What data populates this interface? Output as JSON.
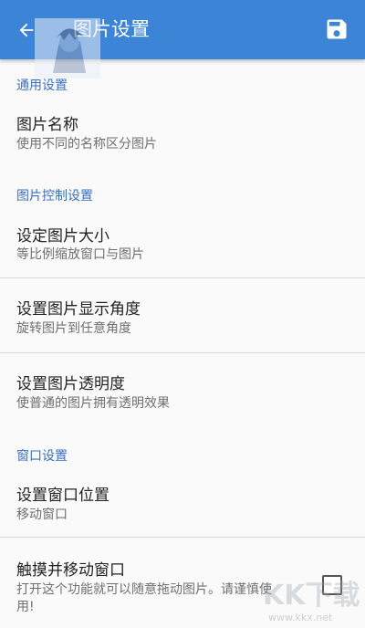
{
  "header": {
    "title": "图片设置",
    "back_icon": "arrow-left-icon",
    "save_icon": "floppy-save-icon",
    "color": "#3b84d6"
  },
  "sections": [
    {
      "title": "通用设置",
      "items": [
        {
          "title": "图片名称",
          "summary": "使用不同的名称区分图片"
        }
      ]
    },
    {
      "title": "图片控制设置",
      "items": [
        {
          "title": "设定图片大小",
          "summary": "等比例缩放窗口与图片"
        },
        {
          "title": "设置图片显示角度",
          "summary": "旋转图片到任意角度"
        },
        {
          "title": "设置图片透明度",
          "summary": "使普通的图片拥有透明效果"
        }
      ]
    },
    {
      "title": "窗口设置",
      "items": [
        {
          "title": "设置窗口位置",
          "summary": "移动窗口"
        },
        {
          "title": "触摸并移动窗口",
          "summary_line1": "打开这个功能就可以随意拖动图片。请谨慎使",
          "summary_line2": "用!",
          "checked": false
        }
      ]
    }
  ],
  "watermark": {
    "site": "www.kkx.net"
  }
}
